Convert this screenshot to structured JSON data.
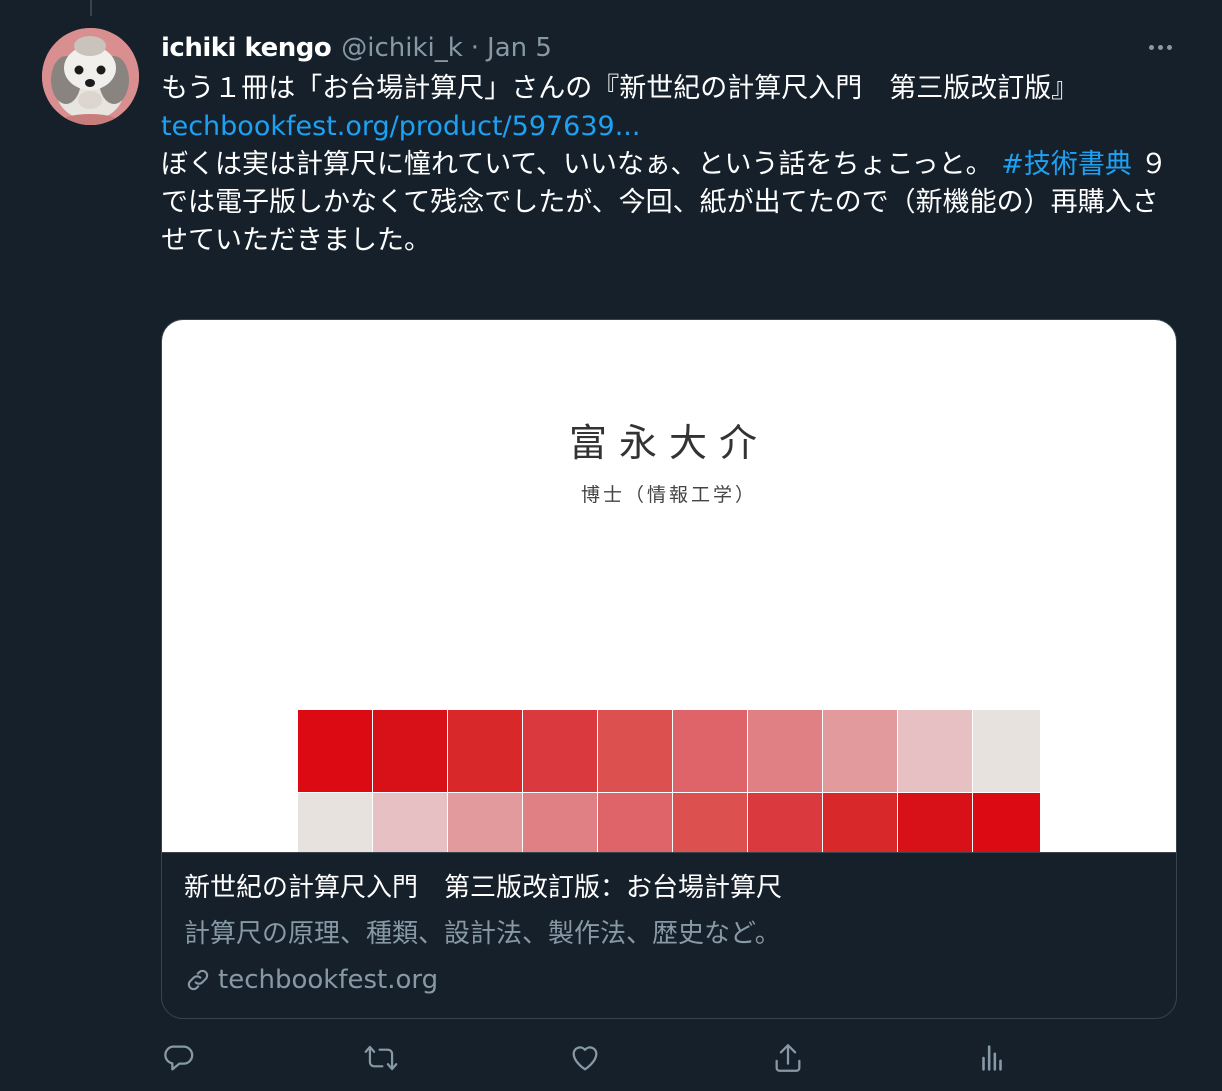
{
  "tweet": {
    "author_name": "ichiki kengo",
    "handle": "@ichiki_k",
    "separator": "·",
    "date": "Jan 5",
    "text_line1": "もう１冊は「お台場計算尺」さんの『新世紀の計算尺入門　第三版改訂版』",
    "link_text": "techbookfest.org/product/597639...",
    "text_line2_before": "ぼくは実は計算尺に憧れていて、いいなぁ、という話をちょこっと。",
    "hashtag": "#技術書典",
    "text_line2_after": "９では電子版しかなくて残念でしたが、今回、紙が出てたので（新機能の）再購入させていただきました。"
  },
  "card": {
    "image_author": "富永大介",
    "image_subtitle": "博士（情報工学）",
    "title": "新世紀の計算尺入門　第三版改訂版：お台場計算尺",
    "description": "計算尺の原理、種類、設計法、製作法、歴史など。",
    "domain": "techbookfest.org",
    "grid_colors_row1": [
      "#dc0a12",
      "#d81018",
      "#d9282a",
      "#da3a3e",
      "#dc5050",
      "#df6469",
      "#e08085",
      "#e29a9c",
      "#e6c0c3",
      "#e8e2df"
    ],
    "grid_colors_row2": [
      "#e8e2df",
      "#e6c0c3",
      "#e29a9c",
      "#e08085",
      "#df6469",
      "#dc5050",
      "#da3a3e",
      "#d9282a",
      "#d81018",
      "#dc0a12"
    ]
  },
  "icons": {
    "more": "more-icon",
    "reply": "reply-icon",
    "retweet": "retweet-icon",
    "like": "like-icon",
    "share": "share-icon",
    "analytics": "analytics-icon",
    "link": "link-icon"
  },
  "colors": {
    "background": "#15202b",
    "link": "#1da1f2",
    "secondary_text": "#8899a6",
    "border": "#38444d"
  }
}
